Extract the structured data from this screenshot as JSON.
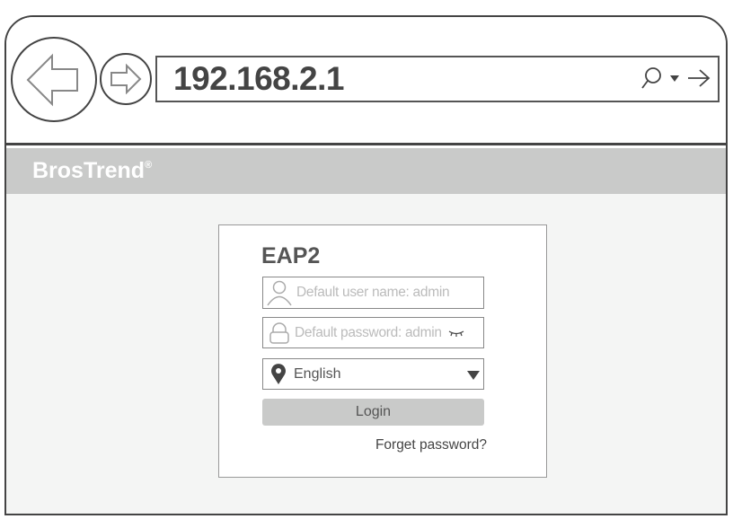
{
  "browser": {
    "url": "192.168.2.1",
    "icons": [
      "back-arrow-icon",
      "forward-arrow-icon",
      "search-icon",
      "dropdown-icon",
      "go-arrow-icon"
    ]
  },
  "brand": {
    "name": "BrosTrend",
    "mark": "®"
  },
  "login": {
    "title": "EAP2",
    "username_placeholder": "Default user name: admin",
    "password_placeholder": "Default password: admin",
    "language": "English",
    "login_label": "Login",
    "forget_label": "Forget password?"
  },
  "colors": {
    "bar": "#c9cac9",
    "body": "#f4f5f4",
    "text": "#444444"
  }
}
